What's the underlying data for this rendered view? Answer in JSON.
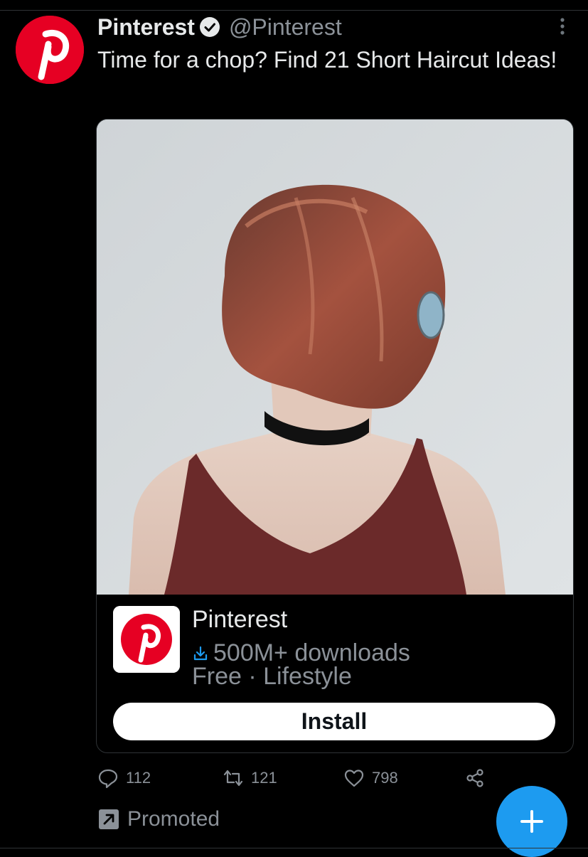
{
  "tweet": {
    "author_name": "Pinterest",
    "author_handle": "@Pinterest",
    "text": "Time for a chop? Find 21 Short Haircut Ideas!",
    "avatar_icon": "pinterest-logo-icon",
    "verified_icon": "verified-badge-icon",
    "more_icon": "more-options-icon"
  },
  "card": {
    "media_description_icon": "photo",
    "app_icon": "pinterest-logo-icon",
    "app_name": "Pinterest",
    "downloads": "500M+ downloads",
    "meta": "Free · Lifestyle",
    "install_label": "Install"
  },
  "actions": {
    "replies": "112",
    "retweets": "121",
    "likes": "798",
    "reply_icon": "reply-icon",
    "retweet_icon": "retweet-icon",
    "like_icon": "heart-icon",
    "share_icon": "share-icon"
  },
  "promoted_label": "Promoted",
  "fab_icon": "compose-plus-icon",
  "colors": {
    "background": "#000000",
    "text": "#e7e9ea",
    "muted": "#8b9198",
    "brand_red": "#e60023",
    "accent_blue": "#1d9bf0"
  }
}
